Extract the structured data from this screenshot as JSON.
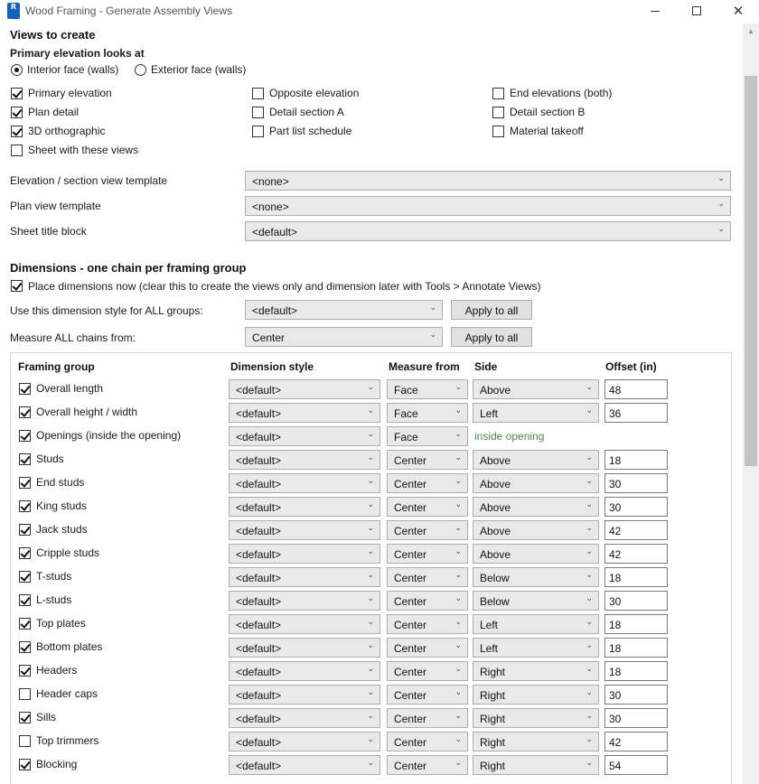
{
  "window": {
    "title": "Wood Framing - Generate Assembly Views",
    "icon_name": "revit-app-icon",
    "icon_text": "R"
  },
  "views": {
    "heading": "Views to create",
    "primary_label": "Primary elevation looks at",
    "radios": [
      {
        "label": "Interior face (walls)",
        "selected": true
      },
      {
        "label": "Exterior face (walls)",
        "selected": false
      }
    ],
    "checkboxes": [
      {
        "label": "Primary elevation",
        "checked": true
      },
      {
        "label": "Plan detail",
        "checked": true
      },
      {
        "label": "3D orthographic",
        "checked": true
      },
      {
        "label": "Sheet with these views",
        "checked": false
      },
      {
        "label": "Opposite elevation",
        "checked": false
      },
      {
        "label": "Detail section A",
        "checked": false
      },
      {
        "label": "Part list schedule",
        "checked": false
      },
      {
        "label": "End elevations (both)",
        "checked": false
      },
      {
        "label": "Detail section B",
        "checked": false
      },
      {
        "label": "Material takeoff",
        "checked": false
      }
    ],
    "templates": [
      {
        "label": "Elevation / section view template",
        "value": "<none>"
      },
      {
        "label": "Plan view template",
        "value": "<none>"
      },
      {
        "label": "Sheet title block",
        "value": "<default>"
      }
    ]
  },
  "dimensions": {
    "heading": "Dimensions - one chain per framing group",
    "place_label": "Place dimensions now  (clear this to create the views only and dimension later with Tools > Annotate Views)",
    "place_checked": true,
    "style_all_label": "Use this dimension style for ALL groups:",
    "style_all_value": "<default>",
    "measure_all_label": "Measure ALL chains from:",
    "measure_all_value": "Center",
    "apply_label": "Apply to all",
    "columns": {
      "group": "Framing group",
      "style": "Dimension style",
      "measure": "Measure from",
      "side": "Side",
      "offset": "Offset (in)"
    },
    "inside_opening_text": "inside opening",
    "rows": [
      {
        "name": "Overall length",
        "checked": true,
        "style": "<default>",
        "measure": "Face",
        "side": "Above",
        "offset": "48"
      },
      {
        "name": "Overall height / width",
        "checked": true,
        "style": "<default>",
        "measure": "Face",
        "side": "Left",
        "offset": "36"
      },
      {
        "name": "Openings (inside the opening)",
        "checked": true,
        "style": "<default>",
        "measure": "Face",
        "side": "",
        "offset": ""
      },
      {
        "name": "Studs",
        "checked": true,
        "style": "<default>",
        "measure": "Center",
        "side": "Above",
        "offset": "18"
      },
      {
        "name": "End studs",
        "checked": true,
        "style": "<default>",
        "measure": "Center",
        "side": "Above",
        "offset": "30"
      },
      {
        "name": "King studs",
        "checked": true,
        "style": "<default>",
        "measure": "Center",
        "side": "Above",
        "offset": "30"
      },
      {
        "name": "Jack studs",
        "checked": true,
        "style": "<default>",
        "measure": "Center",
        "side": "Above",
        "offset": "42"
      },
      {
        "name": "Cripple studs",
        "checked": true,
        "style": "<default>",
        "measure": "Center",
        "side": "Above",
        "offset": "42"
      },
      {
        "name": "T-studs",
        "checked": true,
        "style": "<default>",
        "measure": "Center",
        "side": "Below",
        "offset": "18"
      },
      {
        "name": "L-studs",
        "checked": true,
        "style": "<default>",
        "measure": "Center",
        "side": "Below",
        "offset": "30"
      },
      {
        "name": "Top plates",
        "checked": true,
        "style": "<default>",
        "measure": "Center",
        "side": "Left",
        "offset": "18"
      },
      {
        "name": "Bottom plates",
        "checked": true,
        "style": "<default>",
        "measure": "Center",
        "side": "Left",
        "offset": "18"
      },
      {
        "name": "Headers",
        "checked": true,
        "style": "<default>",
        "measure": "Center",
        "side": "Right",
        "offset": "18"
      },
      {
        "name": "Header caps",
        "checked": false,
        "style": "<default>",
        "measure": "Center",
        "side": "Right",
        "offset": "30"
      },
      {
        "name": "Sills",
        "checked": true,
        "style": "<default>",
        "measure": "Center",
        "side": "Right",
        "offset": "30"
      },
      {
        "name": "Top trimmers",
        "checked": false,
        "style": "<default>",
        "measure": "Center",
        "side": "Right",
        "offset": "42"
      },
      {
        "name": "Blocking",
        "checked": true,
        "style": "<default>",
        "measure": "Center",
        "side": "Right",
        "offset": "54"
      }
    ]
  }
}
